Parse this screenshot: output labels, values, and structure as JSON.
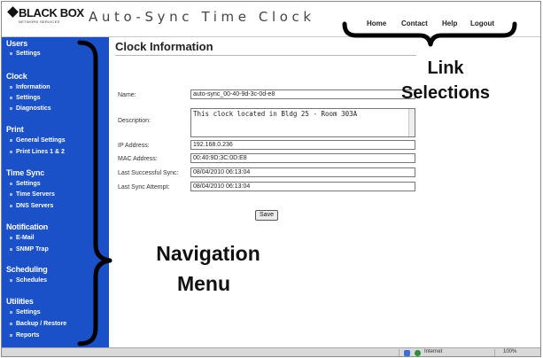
{
  "header": {
    "logo_text": "BLACK BOX",
    "logo_sub": "NETWORK SERVICES",
    "app_title": "Auto-Sync Time Clock",
    "nav": [
      {
        "label": "Home"
      },
      {
        "label": "Contact"
      },
      {
        "label": "Help"
      },
      {
        "label": "Logout"
      }
    ]
  },
  "sidebar": {
    "sections": [
      {
        "title": "Users",
        "items": [
          "Settings"
        ]
      },
      {
        "title": "Clock",
        "items": [
          "Information",
          "Settings",
          "Diagnostics"
        ]
      },
      {
        "title": "Print",
        "items": [
          "General Settings",
          "Print Lines 1 & 2"
        ]
      },
      {
        "title": "Time Sync",
        "items": [
          "Settings",
          "Time Servers",
          "DNS Servers"
        ]
      },
      {
        "title": "Notification",
        "items": [
          "E-Mail",
          "SNMP Trap"
        ]
      },
      {
        "title": "Scheduling",
        "items": [
          "Schedules"
        ]
      },
      {
        "title": "Utilities",
        "items": [
          "Settings",
          "Backup / Restore",
          "Reports"
        ]
      }
    ]
  },
  "main": {
    "title": "Clock Information",
    "fields": {
      "name_label": "Name:",
      "name_value": "auto-sync_00-40-9d-3c-0d-e8",
      "description_label": "Description:",
      "description_value": "This clock located in Bldg 25 - Room 303A",
      "ip_label": "IP Address:",
      "ip_value": "192.168.0.236",
      "mac_label": "MAC Address:",
      "mac_value": "00:40:9D:3C:0D:E8",
      "last_success_label": "Last Successful Sync:",
      "last_success_value": "08/04/2010 06:13:04",
      "last_attempt_label": "Last Sync Attempt:",
      "last_attempt_value": "08/04/2010 06:13:04"
    },
    "save_label": "Save"
  },
  "statusbar": {
    "zone": "Internet",
    "zoom": "100%"
  },
  "annotations": {
    "links": [
      "Link",
      "Selections"
    ],
    "nav": [
      "Navigation",
      "Menu"
    ]
  }
}
